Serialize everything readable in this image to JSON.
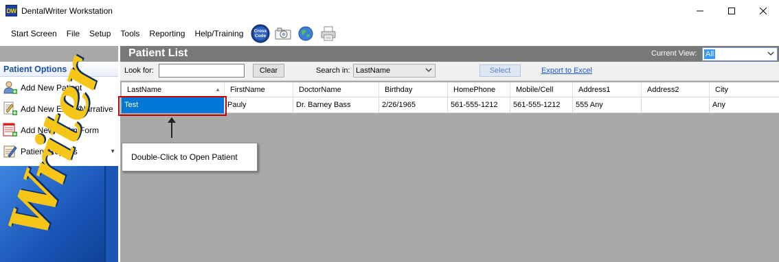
{
  "window": {
    "title": "DentalWriter Workstation",
    "app_icon_text": "DW",
    "controls": [
      "minimize",
      "maximize",
      "close"
    ]
  },
  "menubar": {
    "items": [
      "Start Screen",
      "File",
      "Setup",
      "Tools",
      "Reporting",
      "Help/Training"
    ],
    "toolbar_icons": [
      {
        "name": "cross-code-icon",
        "text": "Cross Code"
      },
      {
        "name": "camera-icon"
      },
      {
        "name": "globe-icon"
      },
      {
        "name": "printer-icon"
      }
    ]
  },
  "sidebar": {
    "header": "Patient Options",
    "items": [
      {
        "label": "Add New Patient",
        "icon": "person-add-icon"
      },
      {
        "label": "Add New Exam/Narrative",
        "icon": "document-add-icon"
      },
      {
        "label": "Add New Claim Form",
        "icon": "claim-form-icon"
      },
      {
        "label": "Patient Reports",
        "icon": "report-icon"
      }
    ],
    "logo_text": "Writer"
  },
  "patient_list": {
    "title": "Patient List",
    "current_view_label": "Current View:",
    "current_view_value": "All",
    "look_for_label": "Look for:",
    "look_for_value": "",
    "clear_button": "Clear",
    "search_in_label": "Search in:",
    "search_in_value": "LastName",
    "select_button": "Select",
    "export_link": "Export to Excel",
    "columns": [
      "LastName",
      "FirstName",
      "DoctorName",
      "Birthday",
      "HomePhone",
      "Mobile/Cell",
      "Address1",
      "Address2",
      "City"
    ],
    "rows": [
      [
        "Test",
        "Pauly",
        "Dr. Barney Bass",
        "2/26/1965",
        "561-555-1212",
        "561-555-1212",
        "555 Any",
        "",
        "Any"
      ]
    ]
  },
  "callout": {
    "text": "Double-Click to Open Patient"
  },
  "colors": {
    "header_gray": "#787878",
    "grid_background": "#a9a9a9",
    "selection_blue": "#0078d7",
    "highlight_red": "#c00000",
    "sidebar_header_blue": "#1d4fa0"
  }
}
